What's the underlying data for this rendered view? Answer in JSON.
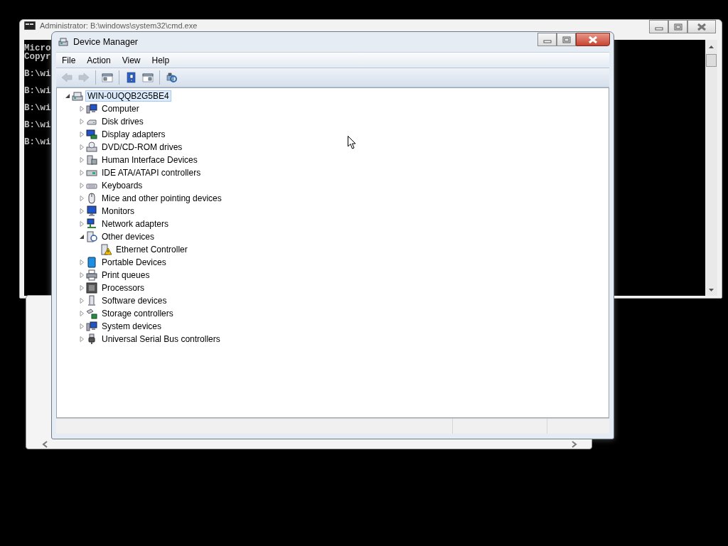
{
  "background_windows": [
    {
      "kind": "console",
      "title": "Administrator: B:\\windows\\system32\\cmd.exe",
      "blocks": [
        [
          "Micro",
          "Copyr"
        ],
        [
          "B:\\wi"
        ],
        [
          "B:\\wi"
        ],
        [
          "B:\\wi"
        ],
        [
          "B:\\wi"
        ],
        [
          "B:\\wi"
        ]
      ]
    },
    {
      "kind": "blank"
    }
  ],
  "window": {
    "title": "Device Manager",
    "menu": [
      "File",
      "Action",
      "View",
      "Help"
    ],
    "toolbar": [
      {
        "kind": "back",
        "disabled": true
      },
      {
        "kind": "forward",
        "disabled": true
      },
      {
        "kind": "separator"
      },
      {
        "kind": "console-tree",
        "disabled": false
      },
      {
        "kind": "separator"
      },
      {
        "kind": "help",
        "disabled": false
      },
      {
        "kind": "action-pane",
        "disabled": false
      },
      {
        "kind": "separator"
      },
      {
        "kind": "scan",
        "disabled": false
      }
    ],
    "tree": [
      {
        "label": "WIN-0UQQB2G5BE4",
        "kind": "root",
        "expanded": true,
        "selected": true,
        "children": [
          {
            "label": "Computer",
            "kind": "computer",
            "expanded": false,
            "selected": false
          },
          {
            "label": "Disk drives",
            "kind": "disk",
            "expanded": false,
            "selected": false
          },
          {
            "label": "Display adapters",
            "kind": "display",
            "expanded": false,
            "selected": false
          },
          {
            "label": "DVD/CD-ROM drives",
            "kind": "dvd",
            "expanded": false,
            "selected": false
          },
          {
            "label": "Human Interface Devices",
            "kind": "hid",
            "expanded": false,
            "selected": false
          },
          {
            "label": "IDE ATA/ATAPI controllers",
            "kind": "ide",
            "expanded": false,
            "selected": false
          },
          {
            "label": "Keyboards",
            "kind": "keyboard",
            "expanded": false,
            "selected": false
          },
          {
            "label": "Mice and other pointing devices",
            "kind": "mouse",
            "expanded": false,
            "selected": false
          },
          {
            "label": "Monitors",
            "kind": "monitor",
            "expanded": false,
            "selected": false
          },
          {
            "label": "Network adapters",
            "kind": "network",
            "expanded": false,
            "selected": false
          },
          {
            "label": "Other devices",
            "kind": "other",
            "expanded": true,
            "selected": false,
            "children": [
              {
                "label": "Ethernet Controller",
                "kind": "warning",
                "selected": false
              }
            ]
          },
          {
            "label": "Portable Devices",
            "kind": "portable",
            "expanded": false,
            "selected": false
          },
          {
            "label": "Print queues",
            "kind": "printer",
            "expanded": false,
            "selected": false
          },
          {
            "label": "Processors",
            "kind": "processor",
            "expanded": false,
            "selected": false
          },
          {
            "label": "Software devices",
            "kind": "software",
            "expanded": false,
            "selected": false
          },
          {
            "label": "Storage controllers",
            "kind": "storage",
            "expanded": false,
            "selected": false
          },
          {
            "label": "System devices",
            "kind": "system",
            "expanded": false,
            "selected": false
          },
          {
            "label": "Universal Serial Bus controllers",
            "kind": "usb",
            "expanded": false,
            "selected": false
          }
        ]
      }
    ]
  }
}
